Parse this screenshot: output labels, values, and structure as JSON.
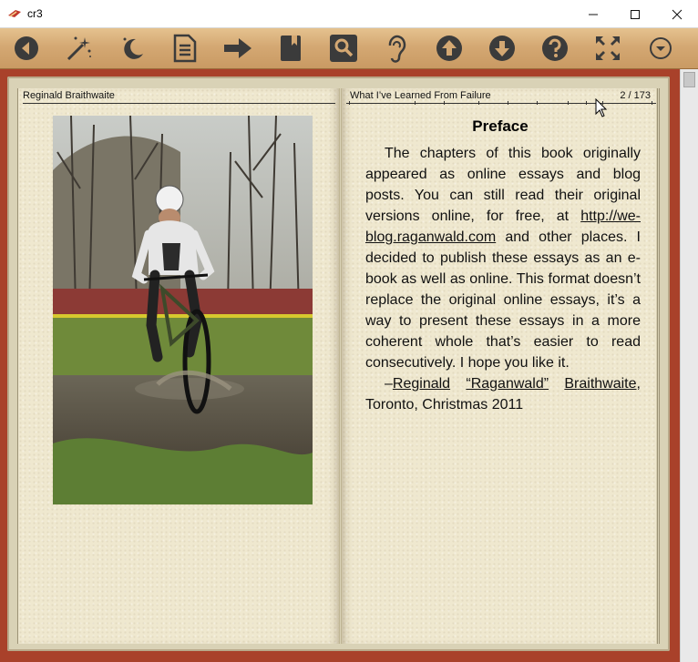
{
  "window": {
    "title": "cr3"
  },
  "toolbar": {
    "icons": [
      "back-icon",
      "magic-wand-icon",
      "night-mode-icon",
      "document-icon",
      "forward-arrow-icon",
      "bookmark-icon",
      "search-icon",
      "listen-icon",
      "page-up-icon",
      "page-down-icon",
      "help-icon",
      "fullscreen-icon",
      "menu-dropdown-icon"
    ]
  },
  "book": {
    "left_header": "Reginald Braithwaite",
    "right_header": "What I’ve Learned From Failure",
    "page_indicator": "2 / 173",
    "chapter_title": "Preface",
    "paragraph1_a": "The chapters of this book originally appeared as online essays and blog posts. You can still read their original versions online, for free, at ",
    "link_url": "http://we-blog.raganwald.com",
    "paragraph1_b": " and other places. I decided to publish these essays as an e-book as well as online. This format doesn’t replace the original online essays, it’s a way to present these essays in a more coherent whole that’s easier to read consecutively. I hope you like it.",
    "dash": "–",
    "author_first": "Reginald",
    "author_nick": "“Raganwald”",
    "author_last": "Braithwaite",
    "signoff": ", Toronto, Christmas 2011"
  },
  "colors": {
    "frame": "#a9412a",
    "wood": "#d4a873",
    "paper": "#efe8cf"
  }
}
